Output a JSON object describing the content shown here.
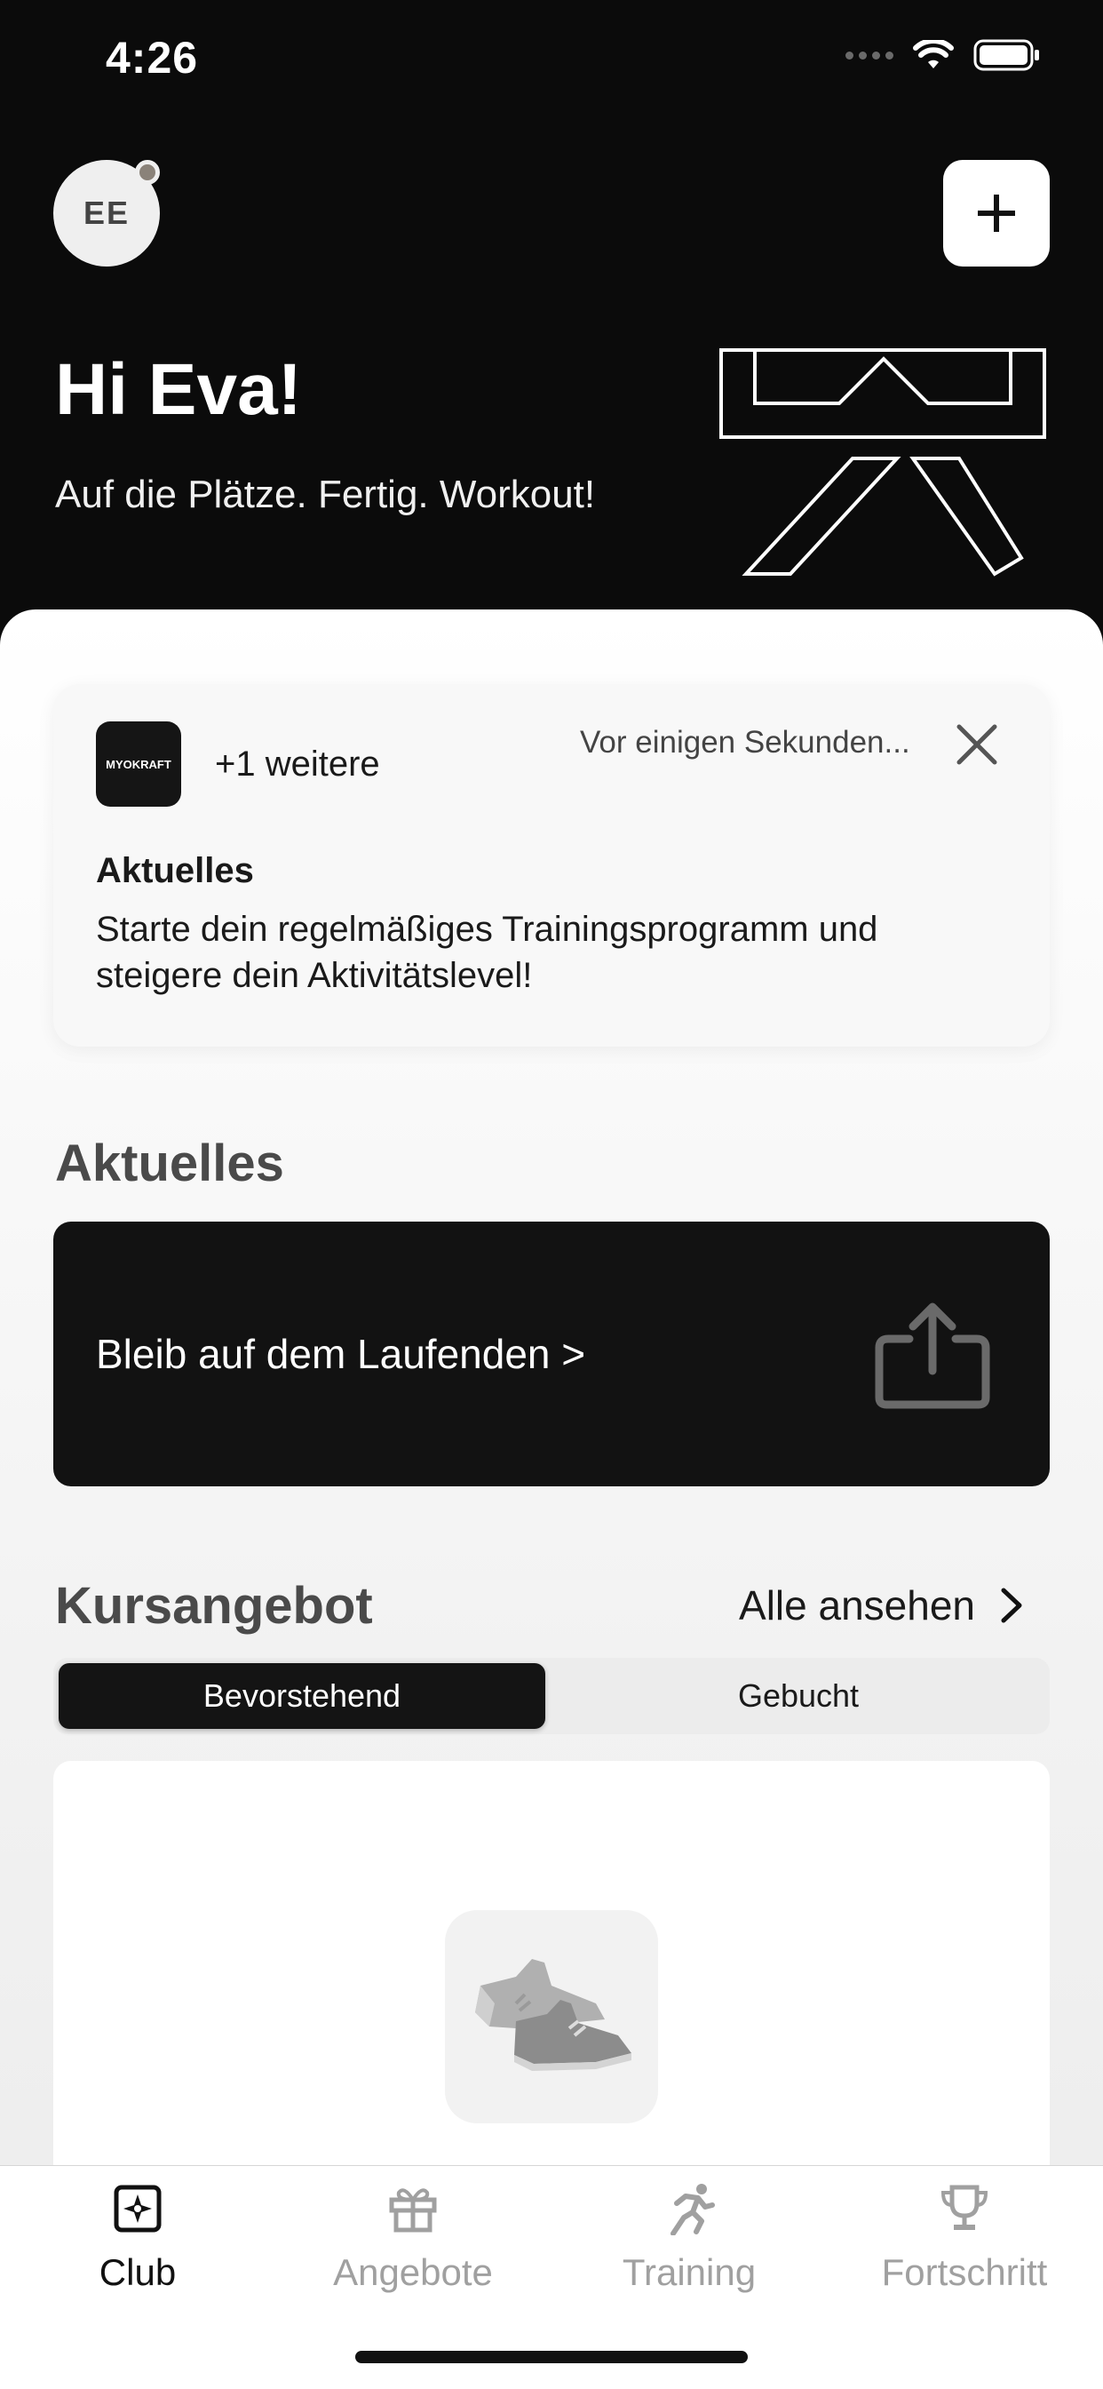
{
  "status_bar": {
    "time": "4:26"
  },
  "header": {
    "avatar_initials": "EE",
    "greeting": "Hi Eva!",
    "subtitle": "Auf die Plätze. Fertig. Workout!"
  },
  "notification": {
    "logo_text": "MYOKRAFT",
    "more": "+1 weitere",
    "time": "Vor einigen Sekunden...",
    "title": "Aktuelles",
    "body": "Starte dein regelmäßiges Trainingsprogramm und steigere dein Aktivitätslevel!"
  },
  "news": {
    "section_title": "Aktuelles",
    "card_text": "Bleib auf dem Laufenden >"
  },
  "courses": {
    "section_title": "Kursangebot",
    "see_all": "Alle ansehen",
    "segments": [
      "Bevorstehend",
      "Gebucht"
    ],
    "selected_segment": "Bevorstehend"
  },
  "tabbar": {
    "items": [
      {
        "label": "Club",
        "icon": "club-icon",
        "active": true
      },
      {
        "label": "Angebote",
        "icon": "gift-icon",
        "active": false
      },
      {
        "label": "Training",
        "icon": "runner-icon",
        "active": false
      },
      {
        "label": "Fortschritt",
        "icon": "trophy-icon",
        "active": false
      }
    ]
  }
}
